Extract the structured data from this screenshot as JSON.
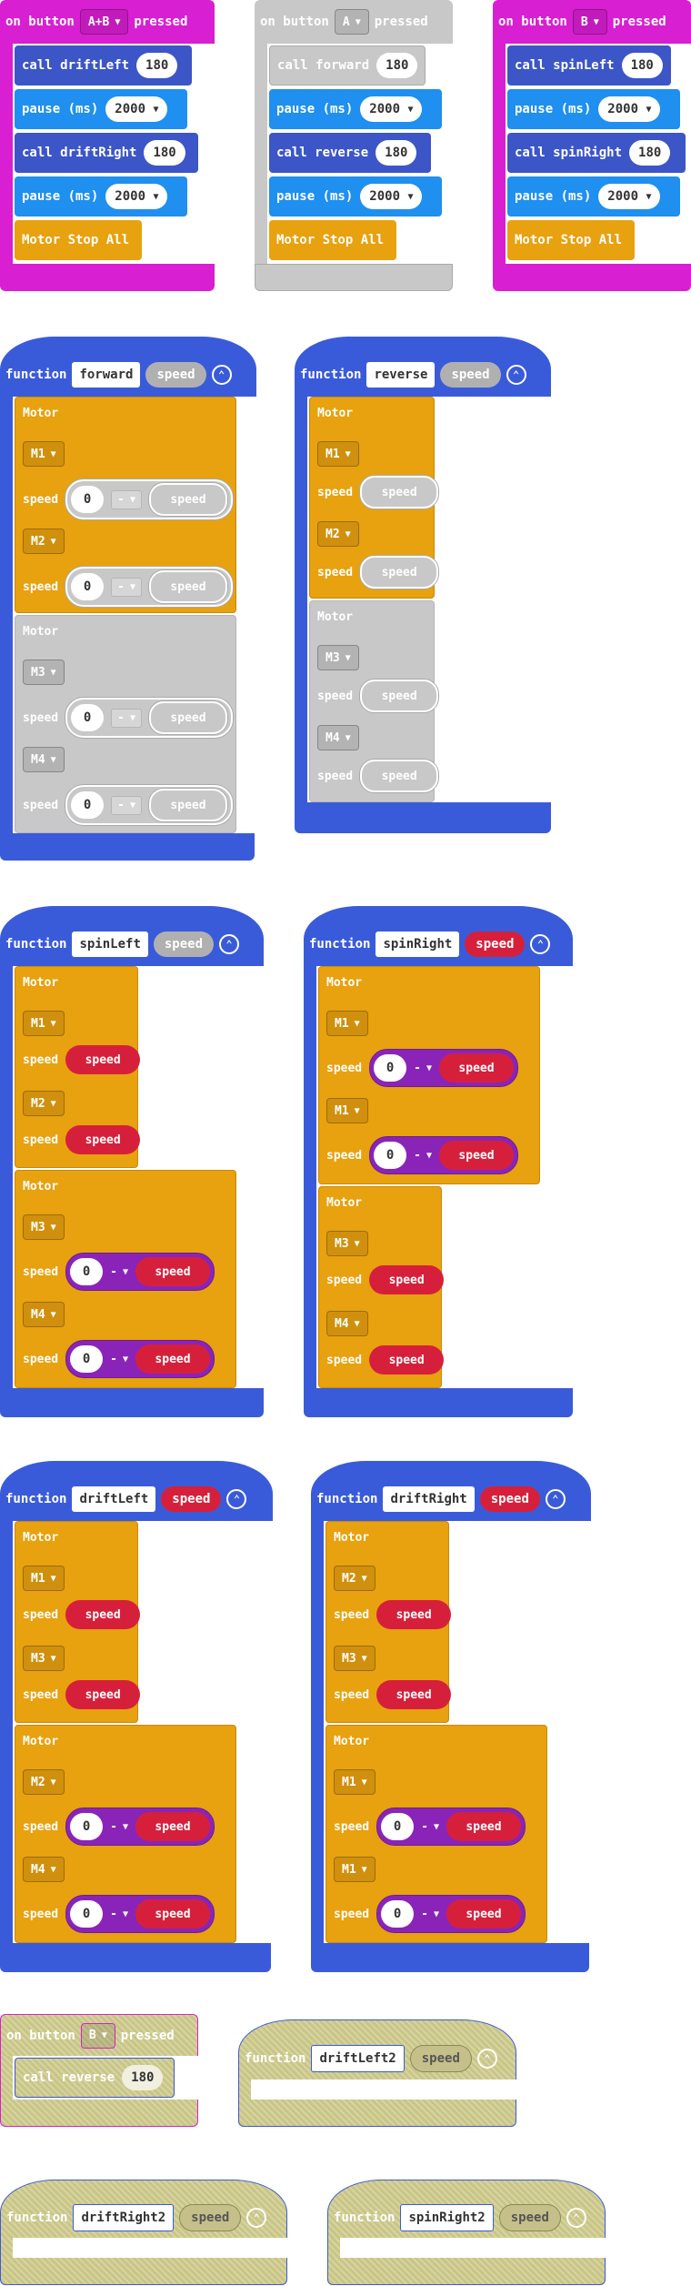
{
  "colors": {
    "magenta": "#d81fd1",
    "blue": "#3a5bd9",
    "callblue": "#3c55c7",
    "pauseblue": "#1f8ff0",
    "orange": "#e8a10f",
    "grey": "#c8c8c8",
    "red": "#d6203b",
    "purple": "#8a24b8",
    "olive": "#c9c585"
  },
  "events": [
    {
      "label_on": "on button",
      "button": "A+B",
      "label_pressed": "pressed",
      "stmts": [
        {
          "kind": "call",
          "text": "call driftLeft",
          "arg": "180"
        },
        {
          "kind": "pause",
          "text": "pause (ms)",
          "arg": "2000"
        },
        {
          "kind": "call",
          "text": "call driftRight",
          "arg": "180"
        },
        {
          "kind": "pause",
          "text": "pause (ms)",
          "arg": "2000"
        },
        {
          "kind": "stop",
          "text": "Motor Stop All"
        }
      ]
    },
    {
      "label_on": "on button",
      "button": "A",
      "label_pressed": "pressed",
      "stmts": [
        {
          "kind": "call",
          "text": "call forward",
          "arg": "180"
        },
        {
          "kind": "pause",
          "text": "pause (ms)",
          "arg": "2000"
        },
        {
          "kind": "call",
          "text": "call reverse",
          "arg": "180"
        },
        {
          "kind": "pause",
          "text": "pause (ms)",
          "arg": "2000"
        },
        {
          "kind": "stop",
          "text": "Motor Stop All"
        }
      ]
    },
    {
      "label_on": "on button",
      "button": "B",
      "label_pressed": "pressed",
      "stmts": [
        {
          "kind": "call",
          "text": "call spinLeft",
          "arg": "180"
        },
        {
          "kind": "pause",
          "text": "pause (ms)",
          "arg": "2000"
        },
        {
          "kind": "call",
          "text": "call spinRight",
          "arg": "180"
        },
        {
          "kind": "pause",
          "text": "pause (ms)",
          "arg": "2000"
        },
        {
          "kind": "stop",
          "text": "Motor Stop All"
        }
      ]
    }
  ],
  "functions": {
    "keyword": "function",
    "param": "speed",
    "motor_label": "Motor",
    "speed_label": "speed",
    "zero": "0",
    "minus": "-",
    "forward": {
      "name": "forward",
      "m": [
        "M1",
        "M2",
        "M3",
        "M4"
      ]
    },
    "reverse": {
      "name": "reverse",
      "m": [
        "M1",
        "M2",
        "M3",
        "M4"
      ]
    },
    "spinLeft": {
      "name": "spinLeft",
      "m": [
        "M1",
        "M2",
        "M3",
        "M4"
      ]
    },
    "spinRight": {
      "name": "spinRight",
      "m": [
        "M1",
        "M1",
        "M3",
        "M4"
      ]
    },
    "driftLeft": {
      "name": "driftLeft",
      "m": [
        "M1",
        "M3",
        "M2",
        "M4"
      ]
    },
    "driftRight": {
      "name": "driftRight",
      "m": [
        "M2",
        "M3",
        "M1",
        "M1"
      ]
    }
  },
  "disabled": {
    "event": {
      "label_on": "on button",
      "button": "B",
      "label_pressed": "pressed",
      "call": "call reverse",
      "arg": "180"
    },
    "driftLeft2": "driftLeft2",
    "driftRight2": "driftRight2",
    "spinRight2": "spinRight2"
  }
}
